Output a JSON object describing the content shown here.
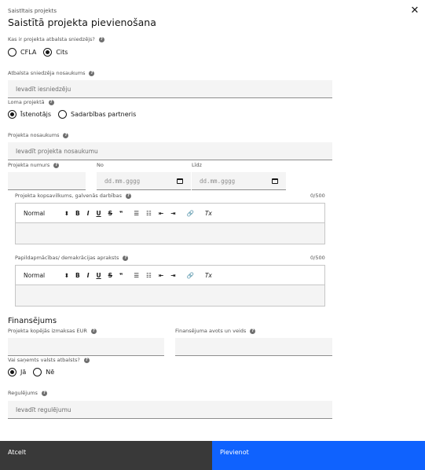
{
  "header": {
    "overline": "Saistītais projekts",
    "title": "Saistītā projekta pievienošana",
    "close_glyph": "✕"
  },
  "support_provider": {
    "question": "Kas ir projekta atbalsta sniedzējs?",
    "options": [
      {
        "label": "CFLA",
        "selected": false
      },
      {
        "label": "Cits",
        "selected": true
      }
    ]
  },
  "support_provider_name": {
    "label": "Atbalsta sniedzēja nosaukums",
    "placeholder": "Ievadīt iesniedzēju"
  },
  "project_role": {
    "label": "Loma projektā",
    "options": [
      {
        "label": "Īstenotājs",
        "selected": true
      },
      {
        "label": "Sadarbības partneris",
        "selected": false
      }
    ]
  },
  "project_name": {
    "label": "Projekta nosaukums",
    "placeholder": "Ievadīt projekta nosaukumu"
  },
  "project_number": {
    "label": "Projekta numurs",
    "value": ""
  },
  "date_from": {
    "label": "No",
    "placeholder": "dd.mm.gggg"
  },
  "date_to": {
    "label": "Līdz",
    "placeholder": "dd.mm.gggg"
  },
  "summary": {
    "label": "Projekta kopsavilkums, galvenās darbības",
    "counter": "0/500"
  },
  "extra_training": {
    "label": "Papildapmācības/ demakrācijas apraksts",
    "counter": "0/500"
  },
  "toolbar": {
    "format": "Normal",
    "format_arrow": "⬍",
    "bold": "B",
    "italic": "I",
    "underline": "U",
    "strike": "S",
    "quote": "❞",
    "ordered_list": "☰",
    "bullet_list": "☷",
    "indent_decrease": "⇤",
    "indent_increase": "⇥",
    "link": "🔗",
    "clear_format": "Tx"
  },
  "financing": {
    "title": "Finansējums",
    "total_label": "Projekta kopējās izmaksas EUR",
    "source_label": "Finansējuma avots un veids"
  },
  "state_aid": {
    "question": "Vai saņemts valsts atbalsts?",
    "options": [
      {
        "label": "Jā",
        "selected": true
      },
      {
        "label": "Nē",
        "selected": false
      }
    ]
  },
  "regulation": {
    "label": "Regulējums",
    "placeholder": "Ievadīt regulējumu"
  },
  "footer": {
    "cancel": "Atcelt",
    "submit": "Pievienot"
  },
  "colors": {
    "primary": "#0f62fe",
    "secondary": "#393939",
    "field_bg": "#f4f4f4"
  }
}
